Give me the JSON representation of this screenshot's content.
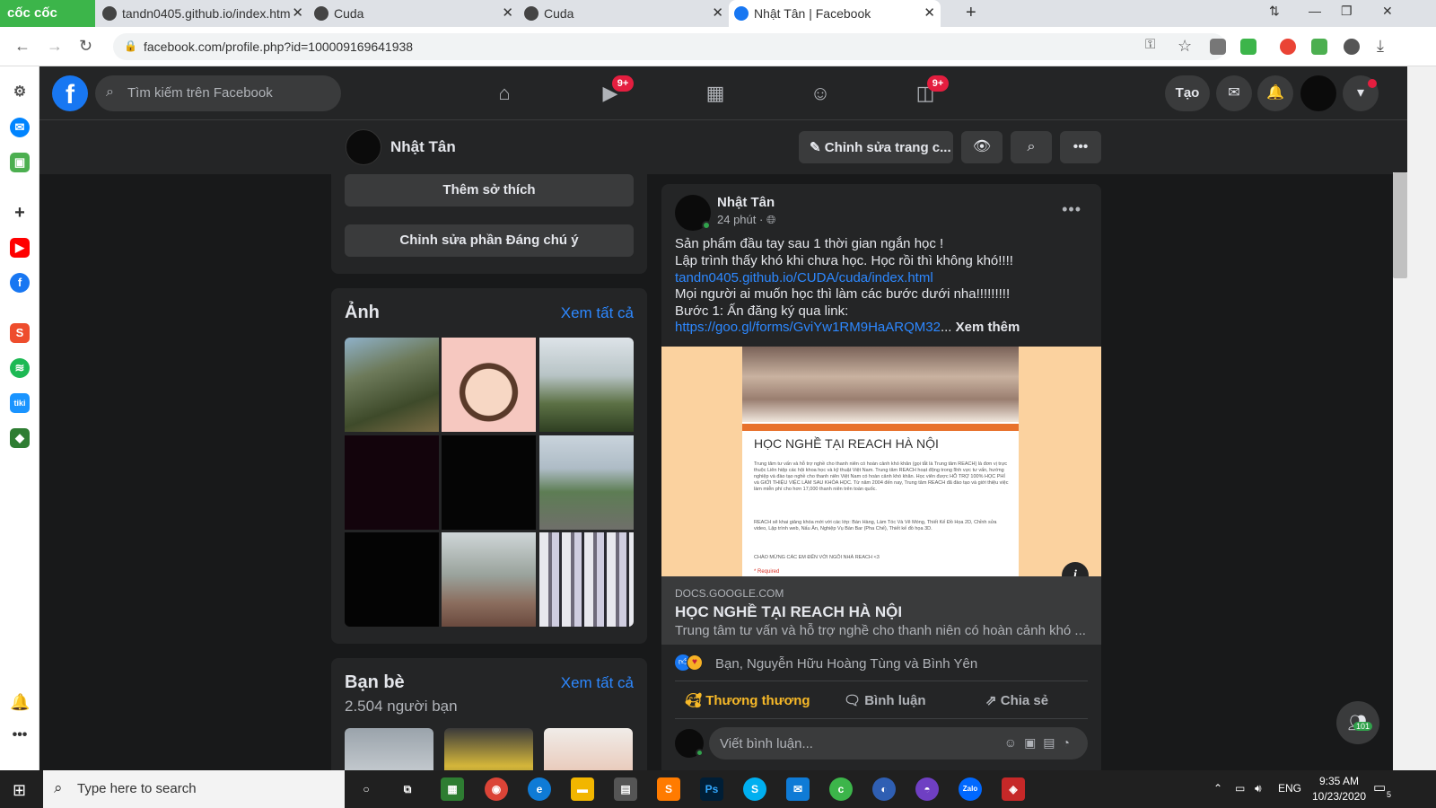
{
  "browser": {
    "brand": "cốc cốc",
    "tabs": [
      {
        "title": "tandn0405.github.io/index.htm",
        "icon": "github-icon"
      },
      {
        "title": "Cuda",
        "icon": "globe-icon"
      },
      {
        "title": "Cuda",
        "icon": "globe-icon"
      },
      {
        "title": "Nhật Tân | Facebook",
        "icon": "facebook-icon"
      }
    ],
    "url": "facebook.com/profile.php?id=100009169641938"
  },
  "fb": {
    "search_placeholder": "Tìm kiếm trên Facebook",
    "watch_badge": "9+",
    "gaming_badge": "9+",
    "create_label": "Tạo"
  },
  "profile": {
    "name": "Nhật Tân",
    "edit_label": "Chỉnh sửa trang c..."
  },
  "left": {
    "add_hobbies": "Thêm sở thích",
    "edit_featured": "Chỉnh sửa phần Đáng chú ý",
    "photos_title": "Ảnh",
    "see_all": "Xem tất cả",
    "friends_title": "Bạn bè",
    "friends_count": "2.504 người bạn"
  },
  "post": {
    "author": "Nhật Tân",
    "time": "24 phút ·",
    "lines": [
      "Sản phẩm đầu tay sau 1 thời gian ngắn học !",
      "Lập trình thấy khó khi chưa học. Học rồi thì không khó!!!!",
      "tandn0405.github.io/CUDA/cuda/index.html",
      "Mọi người ai muốn học thì làm các bước dưới nha!!!!!!!!!",
      "Bước 1: Ấn đăng ký qua link:",
      "https://goo.gl/forms/GviYw1RM9HaARQM32"
    ],
    "ellipsis": "...",
    "see_more": "Xem thêm",
    "form_title": "HỌC NGHỀ TẠI REACH HÀ NỘI",
    "form_para1": "Trung tâm tư vấn và hỗ trợ nghề cho thanh niên có hoàn cảnh khó khăn (gọi tắt là Trung tâm REACH) là đơn vị trực thuộc Liên hiệp các hội khoa học và kỹ thuật Việt Nam. Trung tâm REACH hoạt động trong lĩnh vực tư vấn, hướng nghiệp và đào tạo nghề cho thanh niên Việt Nam có hoàn cảnh khó khăn. Học viên được HỖ TRỢ 100% HỌC PHÍ và GIỚI THIỆU VIỆC LÀM SAU KHÓA HỌC. Từ năm 2004 đến nay, Trung tâm REACH đã đào tạo và giới thiệu việc làm miễn phí cho hơn 17,000 thanh niên trên toàn quốc.",
    "form_para2": "REACH sẽ khai giảng khóa mới với các lớp: Bán Hàng, Làm Tóc Và Vẽ Móng, Thiết Kế Đồ Họa 2D, Chỉnh sửa video, Lập trình web, Nấu Ăn, Nghiệp Vụ Bàn Bar (Pha Chế), Thiết kế đồ họa 3D.",
    "form_para3": "CHÀO MỪNG CÁC EM ĐẾN VỚI NGÔI NHÀ REACH <3",
    "form_required": "* Required",
    "link_domain": "DOCS.GOOGLE.COM",
    "link_title": "HỌC NGHỀ TẠI REACH HÀ NỘI",
    "link_desc": "Trung tâm tư vấn và hỗ trợ nghề cho thanh niên có hoàn cảnh khó ...",
    "reactions_text": "Bạn, Nguyễn Hữu Hoàng Tùng và Bình Yên",
    "action_care": "Thương thương",
    "action_comment": "Bình luận",
    "action_share": "Chia sẻ",
    "comment_placeholder": "Viết bình luận..."
  },
  "chat": {
    "online_count": "101"
  },
  "taskbar": {
    "search_placeholder": "Type here to search",
    "lang": "ENG",
    "time": "9:35 AM",
    "date": "10/23/2020",
    "notif_count": "5"
  }
}
